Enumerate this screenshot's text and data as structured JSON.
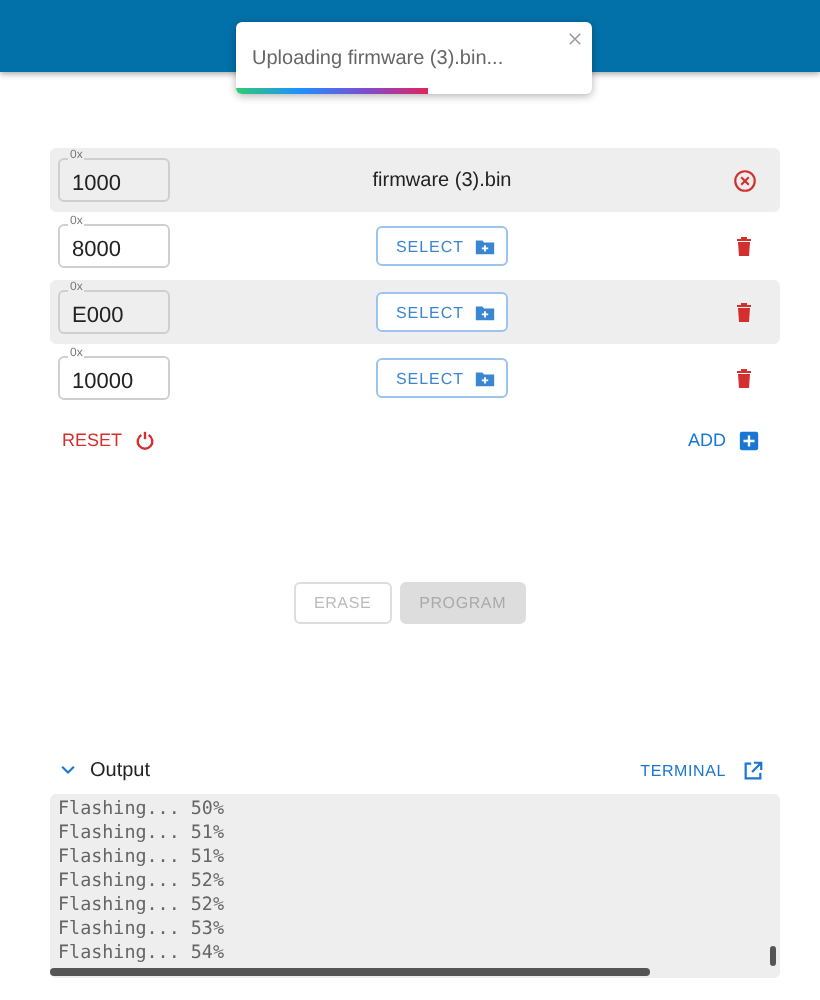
{
  "toast": {
    "message": "Uploading firmware (3).bin...",
    "level": 0.54
  },
  "rows": [
    {
      "kind": "file",
      "address_label": "0x",
      "address": "1000",
      "file": "firmware (3).bin",
      "highlighted": true
    },
    {
      "kind": "select",
      "address_label": "0x",
      "address": "8000",
      "button": "SELECT",
      "highlighted": false
    },
    {
      "kind": "select",
      "address_label": "0x",
      "address": "E000",
      "button": "SELECT",
      "highlighted": true
    },
    {
      "kind": "select",
      "address_label": "0x",
      "address": "10000",
      "button": "SELECT",
      "highlighted": false
    }
  ],
  "actions": {
    "reset": "RESET",
    "add": "ADD"
  },
  "buttons": [
    {
      "label": "ERASE",
      "kind": "outlined",
      "disabled": true
    },
    {
      "label": "PROGRAM",
      "kind": "contained",
      "disabled": true
    }
  ],
  "output": {
    "title": "Output",
    "expanded": true,
    "terminal": "TERMINAL",
    "lines": [
      "Flashing... 50%",
      "Flashing... 51%",
      "Flashing... 51%",
      "Flashing... 52%",
      "Flashing... 52%",
      "Flashing... 53%",
      "Flashing... 54%"
    ]
  }
}
